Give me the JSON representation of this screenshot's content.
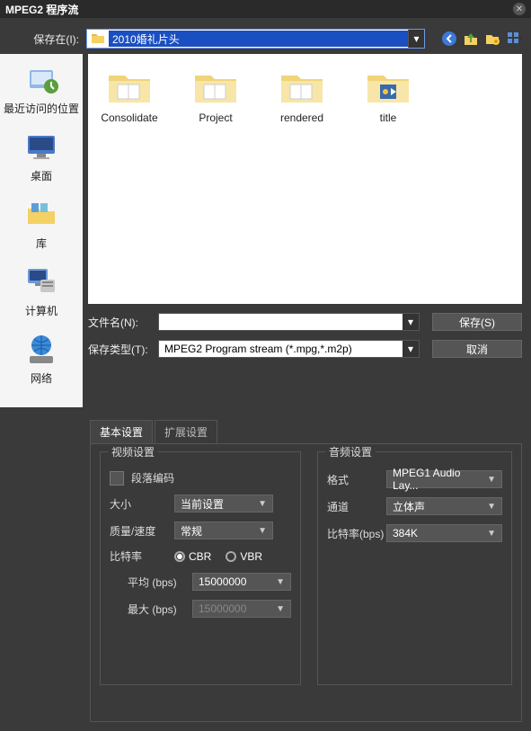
{
  "title": "MPEG2 程序流",
  "saveInLabel": "保存在(I):",
  "pathText": "2010婚礼片头",
  "sidebar": {
    "recent": "最近访问的位置",
    "desktop": "桌面",
    "library": "库",
    "computer": "计算机",
    "network": "网络"
  },
  "folders": [
    {
      "name": "Consolidate"
    },
    {
      "name": "Project"
    },
    {
      "name": "rendered"
    },
    {
      "name": "title"
    }
  ],
  "filenameLabel": "文件名(N):",
  "filenameValue": "",
  "filetypeLabel": "保存类型(T):",
  "filetypeValue": "MPEG2 Program stream (*.mpg,*.m2p)",
  "saveBtn": "保存(S)",
  "cancelBtn": "取消",
  "tabs": {
    "basic": "基本设置",
    "advanced": "扩展设置"
  },
  "video": {
    "title": "视频设置",
    "segEncode": "段落编码",
    "sizeLabel": "大小",
    "sizeValue": "当前设置",
    "qualityLabel": "质量/速度",
    "qualityValue": "常规",
    "bitrateLabel": "比特率",
    "cbr": "CBR",
    "vbr": "VBR",
    "avgLabel": "平均 (bps)",
    "avgValue": "15000000",
    "maxLabel": "最大 (bps)",
    "maxValue": "15000000"
  },
  "audio": {
    "title": "音频设置",
    "formatLabel": "格式",
    "formatValue": "MPEG1 Audio Lay...",
    "channelLabel": "通道",
    "channelValue": "立体声",
    "bitrateLabel": "比特率(bps)",
    "bitrateValue": "384K"
  }
}
